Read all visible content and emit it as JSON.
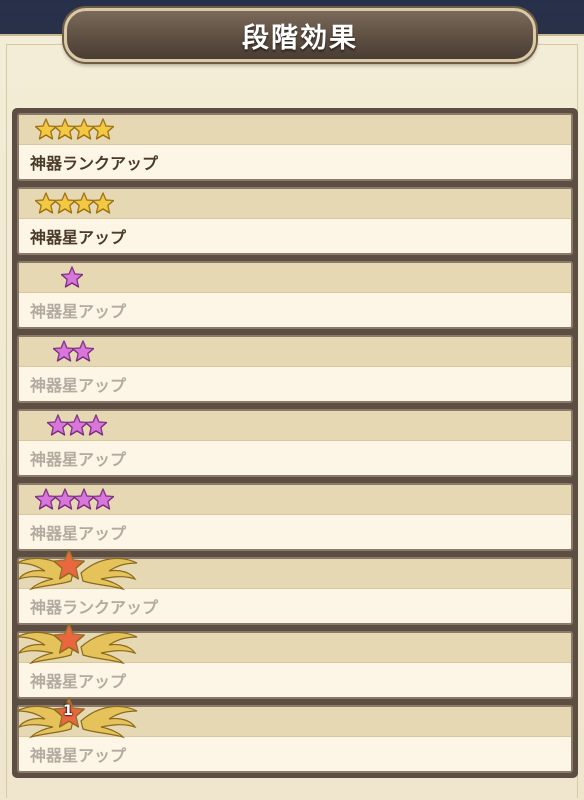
{
  "header": {
    "title": "段階効果"
  },
  "colors": {
    "gold_star": "#f2c230",
    "pink_star": "#d468d6",
    "red_star": "#e8572c",
    "active_text": "#4a3a2a",
    "inactive_text": "#b3aba0"
  },
  "rows": [
    {
      "label": "神器ランクアップ",
      "badge": "gold-stars",
      "star_count": 4,
      "active": true
    },
    {
      "label": "神器星アップ",
      "badge": "gold-stars",
      "star_count": 4,
      "active": true
    },
    {
      "label": "神器星アップ",
      "badge": "pink-stars",
      "star_count": 1,
      "active": false
    },
    {
      "label": "神器星アップ",
      "badge": "pink-stars",
      "star_count": 2,
      "active": false
    },
    {
      "label": "神器星アップ",
      "badge": "pink-stars",
      "star_count": 3,
      "active": false
    },
    {
      "label": "神器星アップ",
      "badge": "pink-stars",
      "star_count": 4,
      "active": false
    },
    {
      "label": "神器ランクアップ",
      "badge": "winged-star",
      "active": false
    },
    {
      "label": "神器星アップ",
      "badge": "winged-star",
      "active": false
    },
    {
      "label": "神器星アップ",
      "badge": "winged-star",
      "badge_number": "1",
      "active": false
    }
  ]
}
